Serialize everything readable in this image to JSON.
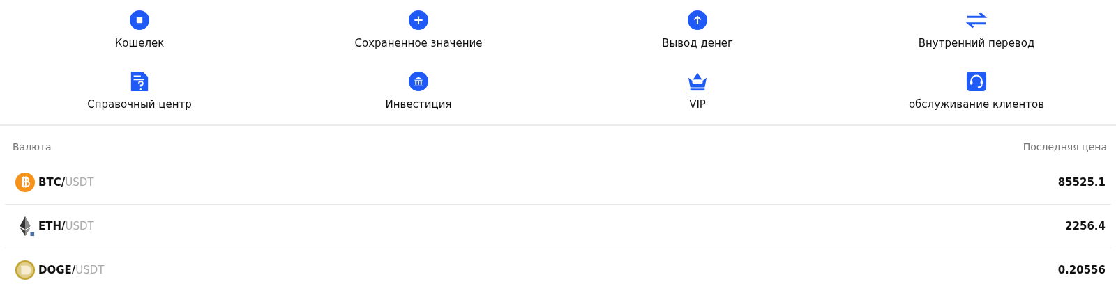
{
  "menu": [
    {
      "label": "Кошелек",
      "kind": "stop"
    },
    {
      "label": "Сохраненное значение",
      "kind": "plus"
    },
    {
      "label": "Вывод денег",
      "kind": "up"
    },
    {
      "label": "Внутренний перевод",
      "kind": "swap"
    },
    {
      "label": "Справочный центр",
      "kind": "help"
    },
    {
      "label": "Инвестиция",
      "kind": "bank"
    },
    {
      "label": "VIP",
      "kind": "crown"
    },
    {
      "label": "обслуживание клиентов",
      "kind": "headset"
    }
  ],
  "table": {
    "columns": [
      "Валюта",
      "Последняя цена"
    ],
    "rows": [
      {
        "kind": "btc",
        "base": "BTC/",
        "quote": "USDT",
        "price": "85525.1"
      },
      {
        "kind": "eth",
        "base": "ETH/",
        "quote": "USDT",
        "price": "2256.4"
      },
      {
        "kind": "doge",
        "base": "DOGE/",
        "quote": "USDT",
        "price": "0.20556"
      }
    ]
  }
}
